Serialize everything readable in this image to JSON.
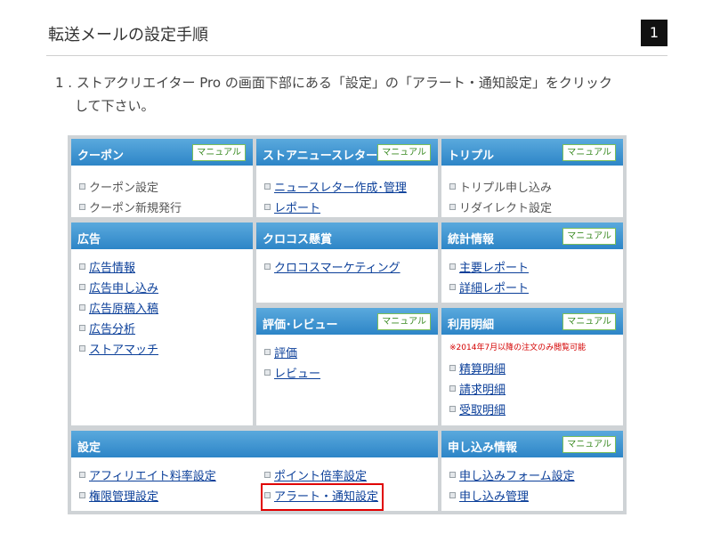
{
  "header": {
    "title": "転送メールの設定手順",
    "page_number": "1"
  },
  "step": {
    "line1": "1 . ストアクリエイター Pro の画面下部にある「設定」の「アラート・通知設定」をクリック",
    "line2": "して下さい。"
  },
  "manual_label": "マニュアル",
  "panels": {
    "coupon": {
      "title": "クーポン",
      "items": [
        "クーポン設定",
        "クーポン新規発行"
      ]
    },
    "newsletter": {
      "title": "ストアニュースレター",
      "items": [
        "ニュースレター作成･管理",
        "レポート"
      ]
    },
    "triple": {
      "title": "トリプル",
      "items": [
        "トリプル申し込み",
        "リダイレクト設定"
      ]
    },
    "ad": {
      "title": "広告",
      "items": [
        "広告情報",
        "広告申し込み",
        "広告原稿入稿",
        "広告分析",
        "ストアマッチ"
      ]
    },
    "crocos": {
      "title": "クロコス懸賞",
      "items": [
        "クロコスマーケティング"
      ]
    },
    "stats": {
      "title": "統計情報",
      "items": [
        "主要レポート",
        "詳細レポート"
      ]
    },
    "review": {
      "title": "評価･レビュー",
      "items": [
        "評価",
        "レビュー"
      ]
    },
    "usage": {
      "title": "利用明細",
      "note": "※2014年7月以降の注文のみ閲覧可能",
      "items": [
        "精算明細",
        "請求明細",
        "受取明細"
      ]
    },
    "settings": {
      "title": "設定",
      "col1": [
        "アフィリエイト料率設定",
        "権限管理設定"
      ],
      "col2": [
        "ポイント倍率設定",
        "アラート・通知設定"
      ]
    },
    "application": {
      "title": "申し込み情報",
      "items": [
        "申し込みフォーム設定",
        "申し込み管理"
      ]
    }
  }
}
